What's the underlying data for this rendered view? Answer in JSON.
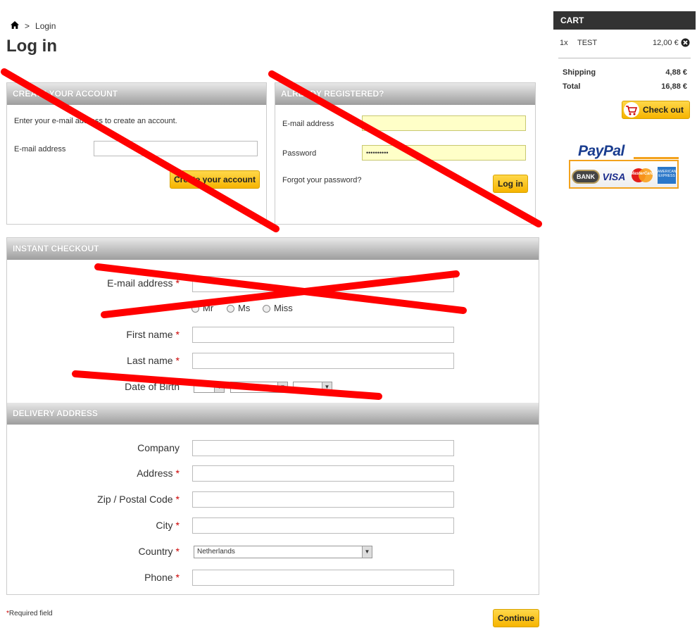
{
  "breadcrumb": {
    "home_icon": "home-icon",
    "separator": ">",
    "current": "Login"
  },
  "page_title": "Log in",
  "create_account": {
    "header": "CREATE YOUR ACCOUNT",
    "intro": "Enter your e-mail address to create an account.",
    "email_label": "E-mail address",
    "email_value": "",
    "button": "Create your account"
  },
  "registered": {
    "header": "ALREADY REGISTERED?",
    "email_label": "E-mail address",
    "email_value": "",
    "password_label": "Password",
    "password_value": "••••••••••",
    "forgot": "Forgot your password?",
    "button": "Log in"
  },
  "instant_checkout": {
    "header": "INSTANT CHECKOUT",
    "email_label": "E-mail address",
    "title_options": [
      "Mr",
      "Ms",
      "Miss"
    ],
    "first_name_label": "First name",
    "last_name_label": "Last name",
    "dob_label": "Date of Birth",
    "dob_day": "-",
    "dob_month": "",
    "dob_year": ""
  },
  "delivery": {
    "header": "DELIVERY ADDRESS",
    "company_label": "Company",
    "address_label": "Address",
    "zip_label": "Zip / Postal Code",
    "city_label": "City",
    "country_label": "Country",
    "country_value": "Netherlands",
    "phone_label": "Phone"
  },
  "required_mark": "*",
  "required_note": "Required field",
  "continue_button": "Continue",
  "cart": {
    "header": "CART",
    "item_qty": "1x",
    "item_name": "TEST",
    "item_price": "12,00 €",
    "remove_icon": "remove-circle-icon",
    "shipping_label": "Shipping",
    "shipping_value": "4,88 €",
    "total_label": "Total",
    "total_value": "16,88 €",
    "checkout_button": "Check out",
    "cart_icon": "shopping-cart-icon"
  },
  "payment": {
    "brand": "PayPal",
    "cards": [
      "BANK",
      "VISA",
      "MasterCard",
      "AMERICAN EXPRESS"
    ]
  },
  "colors": {
    "accent_yellow": "#f6b400",
    "header_gray": "#9d9d9d",
    "cart_dark": "#333333",
    "strike_red": "#ff0000"
  }
}
